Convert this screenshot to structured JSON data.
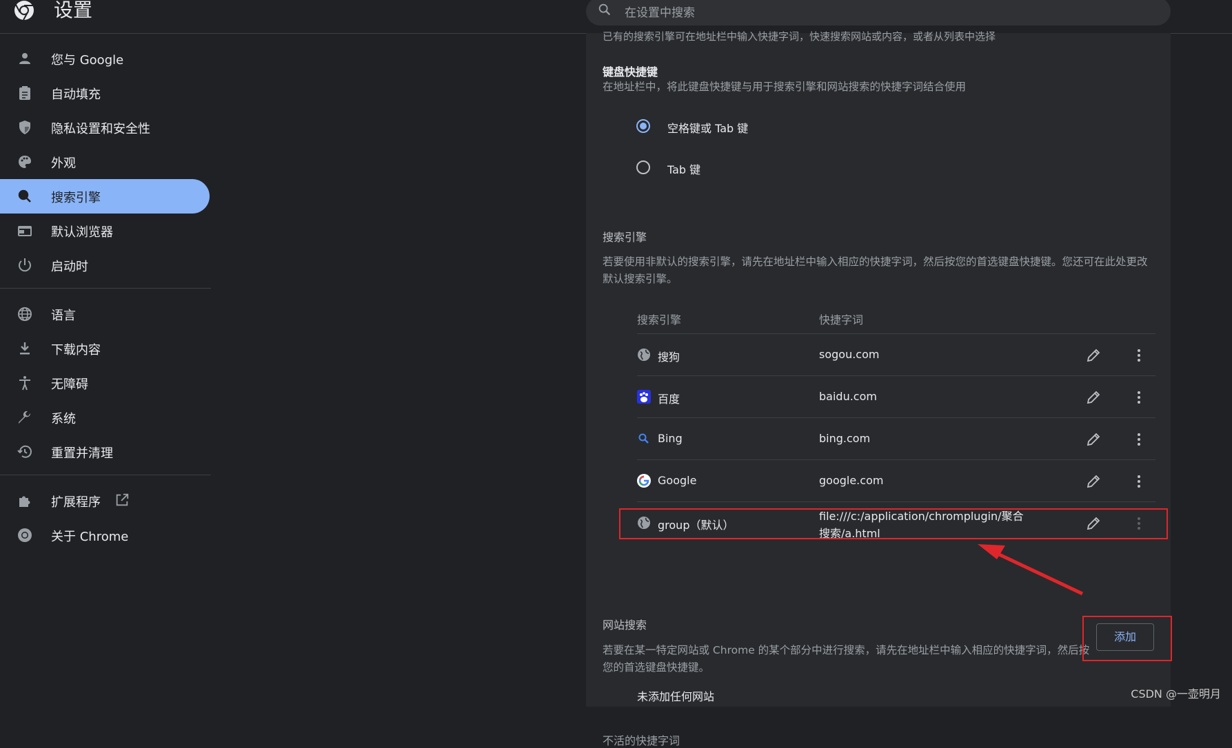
{
  "header": {
    "title": "设置",
    "search_placeholder": "在设置中搜索"
  },
  "sidebar": {
    "items": [
      {
        "label": "您与 Google",
        "icon": "person-icon"
      },
      {
        "label": "自动填充",
        "icon": "clipboard-icon"
      },
      {
        "label": "隐私设置和安全性",
        "icon": "shield-icon"
      },
      {
        "label": "外观",
        "icon": "palette-icon"
      },
      {
        "label": "搜索引擎",
        "icon": "search-icon",
        "active": true
      },
      {
        "label": "默认浏览器",
        "icon": "browser-icon"
      },
      {
        "label": "启动时",
        "icon": "power-icon"
      },
      {
        "label": "语言",
        "icon": "globe-icon"
      },
      {
        "label": "下载内容",
        "icon": "download-icon"
      },
      {
        "label": "无障碍",
        "icon": "accessibility-icon"
      },
      {
        "label": "系统",
        "icon": "wrench-icon"
      },
      {
        "label": "重置并清理",
        "icon": "restore-icon"
      },
      {
        "label": "扩展程序",
        "icon": "puzzle-icon"
      },
      {
        "label": "关于 Chrome",
        "icon": "chrome-icon"
      }
    ]
  },
  "content": {
    "cut_text": "已有的搜索引擎可在地址栏中输入快捷字词，快速搜索网站或内容，或者从列表中选择",
    "shortcut": {
      "title": "键盘快捷键",
      "desc": "在地址栏中，将此键盘快捷键与用于搜索引擎和网站搜索的快捷字词结合使用",
      "options": [
        "空格键或 Tab 键",
        "Tab 键"
      ],
      "selected": 0
    },
    "engines": {
      "title": "搜索引擎",
      "desc": "若要使用非默认的搜索引擎，请先在地址栏中输入相应的快捷字词，然后按您的首选键盘快捷键。您还可在此处更改默认搜索引擎。",
      "col_engine": "搜索引擎",
      "col_keyword": "快捷字词",
      "rows": [
        {
          "name": "搜狗",
          "keyword": "sogou.com",
          "favicon": "globe-icon"
        },
        {
          "name": "百度",
          "keyword": "baidu.com",
          "favicon": "baidu-icon"
        },
        {
          "name": "Bing",
          "keyword": "bing.com",
          "favicon": "bing-search-icon"
        },
        {
          "name": "Google",
          "keyword": "google.com",
          "favicon": "google-icon"
        },
        {
          "name": "group（默认）",
          "keyword": "file:///c:/application/chromplugin/聚合搜索/a.html",
          "favicon": "globe-icon"
        }
      ]
    },
    "site_search": {
      "title": "网站搜索",
      "desc": "若要在某一特定网站或 Chrome 的某个部分中进行搜索，请先在地址栏中输入相应的快捷字词，然后按您的首选键盘快捷键。",
      "add_label": "添加",
      "empty_text": "未添加任何网站"
    },
    "bottom_cut": "不活的快捷字词"
  },
  "watermark": "CSDN @一壶明月",
  "colors": {
    "accent": "#8ab4f8",
    "annotation_red": "#e0262b",
    "bg": "#202124",
    "card": "#292a2d"
  }
}
